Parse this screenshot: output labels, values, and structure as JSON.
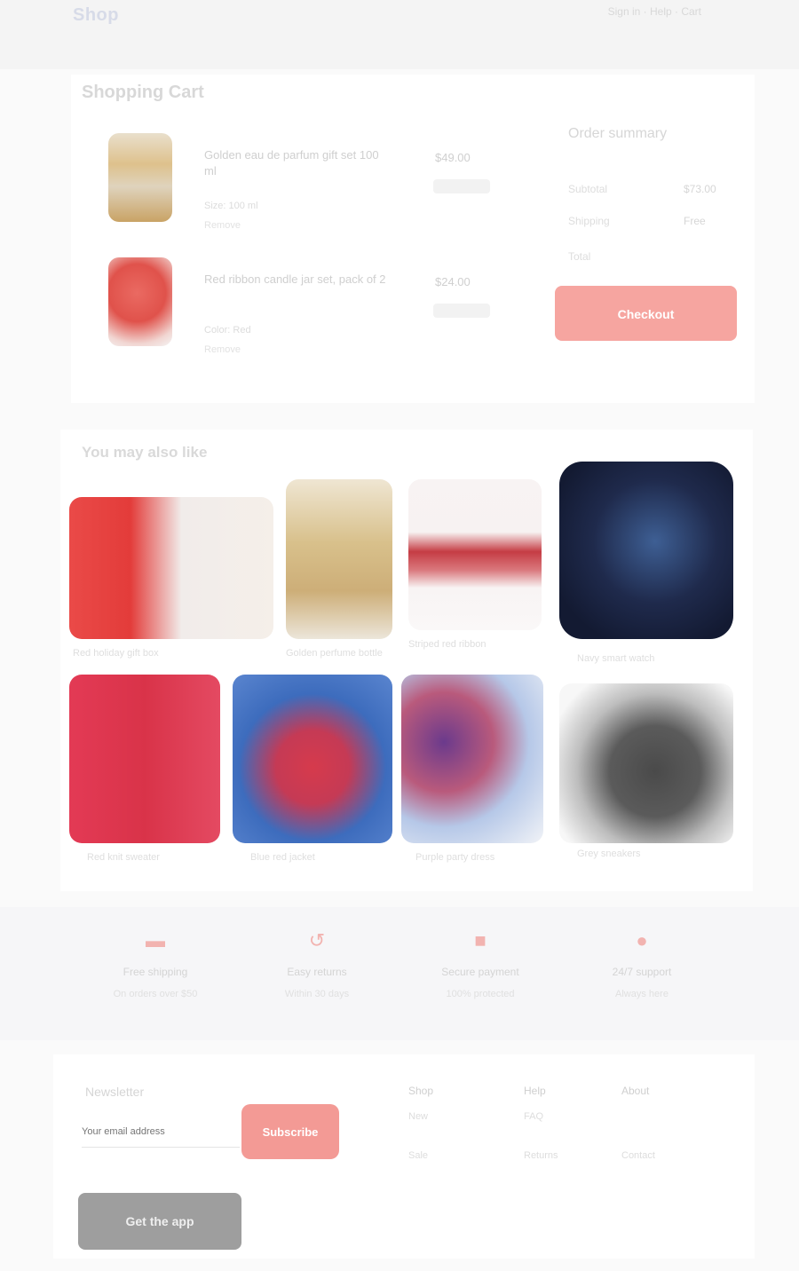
{
  "header": {
    "logo": "Shop",
    "links": "Sign in · Help · Cart"
  },
  "cart": {
    "title": "Shopping Cart",
    "items": [
      {
        "name": "Golden eau de parfum gift set 100 ml",
        "variant": "Size: 100 ml",
        "price": "$49.00",
        "remove": "Remove"
      },
      {
        "name": "Red ribbon candle jar set, pack of 2",
        "variant": "Color: Red",
        "price": "$24.00",
        "remove": "Remove"
      }
    ]
  },
  "summary": {
    "title": "Order summary",
    "subtotal_label": "Subtotal",
    "subtotal_value": "$73.00",
    "shipping_label": "Shipping",
    "shipping_value": "Free",
    "total_label": "Total",
    "checkout_label": "Checkout"
  },
  "recommendations": {
    "title": "You may also like",
    "products": [
      {
        "name": "Red holiday gift box"
      },
      {
        "name": "Golden perfume bottle"
      },
      {
        "name": "Striped red ribbon"
      },
      {
        "name": "Navy smart watch"
      },
      {
        "name": "Red knit sweater"
      },
      {
        "name": "Blue red jacket"
      },
      {
        "name": "Purple party dress"
      },
      {
        "name": "Grey sneakers"
      }
    ]
  },
  "features": [
    {
      "icon": "truck-icon",
      "glyph": "▬",
      "title": "Free shipping",
      "subtitle": "On orders over $50"
    },
    {
      "icon": "return-icon",
      "glyph": "↺",
      "title": "Easy returns",
      "subtitle": "Within 30 days"
    },
    {
      "icon": "lock-icon",
      "glyph": "■",
      "title": "Secure payment",
      "subtitle": "100% protected"
    },
    {
      "icon": "support-icon",
      "glyph": "●",
      "title": "24/7 support",
      "subtitle": "Always here"
    }
  ],
  "footer": {
    "newsletter_title": "Newsletter",
    "email_placeholder": "Your email address",
    "subscribe_label": "Subscribe",
    "app_badge": "Get the app",
    "columns": [
      {
        "title": "Shop",
        "links": [
          "New",
          "Sale"
        ]
      },
      {
        "title": "Help",
        "links": [
          "FAQ",
          "Returns"
        ]
      },
      {
        "title": "About",
        "links": [
          "Contact"
        ]
      }
    ]
  },
  "colors": {
    "accent": "#f39a95",
    "panel": "#ffffff",
    "page": "#fafafa"
  }
}
